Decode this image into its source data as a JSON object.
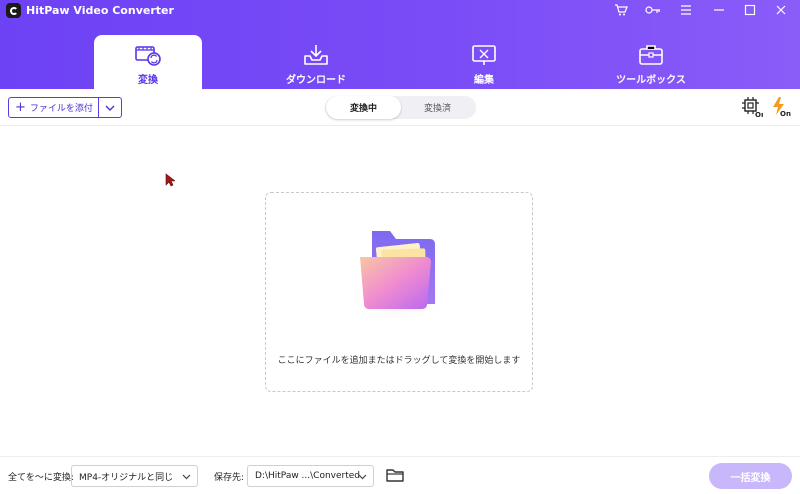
{
  "window": {
    "title": "HitPaw Video Converter"
  },
  "titlebar_icons": [
    "cart-icon",
    "key-icon",
    "menu-icon",
    "minimize-icon",
    "maximize-icon",
    "close-icon"
  ],
  "tabs": [
    {
      "label": "変換",
      "icon": "film-convert-icon",
      "active": true
    },
    {
      "label": "ダウンロード",
      "icon": "download-tray-icon",
      "active": false
    },
    {
      "label": "編集",
      "icon": "edit-scissors-icon",
      "active": false
    },
    {
      "label": "ツールボックス",
      "icon": "toolbox-icon",
      "active": false
    }
  ],
  "toolbar": {
    "add_file_label": "ファイルを添付",
    "segments": [
      {
        "label": "変換中",
        "active": true
      },
      {
        "label": "変換済",
        "active": false
      }
    ],
    "hw_accel_icon": "hardware-accel-on-icon",
    "speed_icon": "lightning-on-icon"
  },
  "dropzone": {
    "text": "ここにファイルを追加またはドラッグして変換を開始します"
  },
  "bottom": {
    "convert_all_label": "全てを～に変換:",
    "format_value": "MP4-オリジナルと同じ",
    "save_label": "保存先:",
    "save_path": "D:\\HitPaw ...\\Converted",
    "convert_button": "一括変換"
  },
  "colors": {
    "brand_purple": "#6d42f5",
    "accent_orange": "#f59a1b",
    "button_disabled": "#c9b7fb"
  }
}
